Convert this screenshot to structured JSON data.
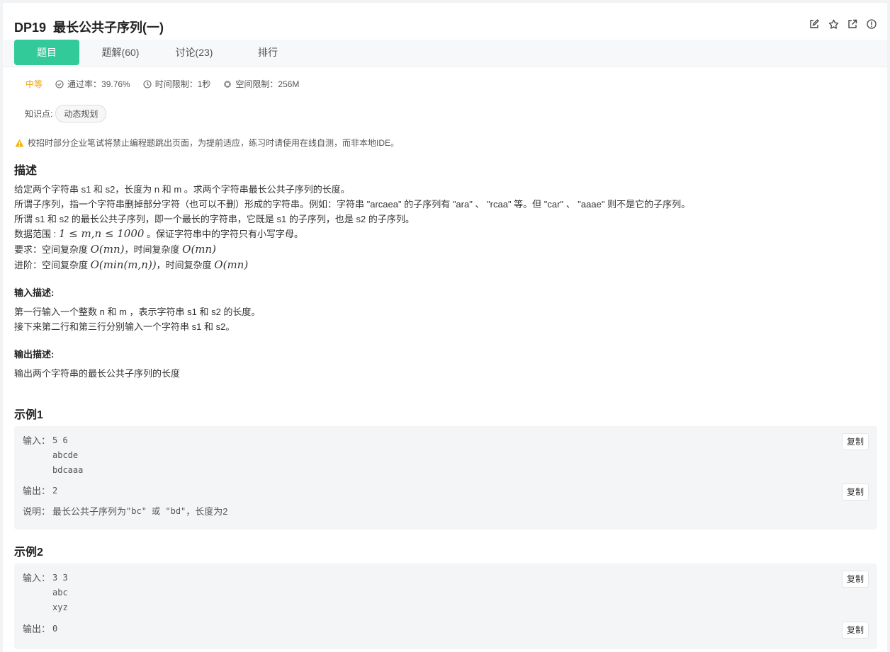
{
  "problem": {
    "title": "DP19  最长公共子序列(一)"
  },
  "header_icons": [
    "edit-icon",
    "star-icon",
    "external-link-icon",
    "info-icon"
  ],
  "tabs": [
    {
      "label": "题目",
      "active": true
    },
    {
      "label": "题解(60)",
      "active": false
    },
    {
      "label": "讨论(23)",
      "active": false
    },
    {
      "label": "排行",
      "active": false
    }
  ],
  "meta": {
    "difficulty": "中等",
    "pass_rate": "通过率：39.76%",
    "time_limit": "时间限制：1秒",
    "space_limit": "空间限制：256M"
  },
  "knowledge": {
    "label": "知识点:",
    "tags": [
      "动态规划"
    ]
  },
  "warning": "校招时部分企业笔试将禁止编程题跳出页面，为提前适应，练习时请使用在线自测，而非本地IDE。",
  "description": {
    "heading": "描述",
    "line1": "给定两个字符串 s1 和 s2，长度为 n 和 m  。求两个字符串最长公共子序列的长度。",
    "line2": "所谓子序列，指一个字符串删掉部分字符（也可以不删）形成的字符串。例如：字符串 \"arcaea\" 的子序列有 \"ara\" 、 \"rcaa\" 等。但 \"car\" 、 \"aaae\" 则不是它的子序列。",
    "line3": "所谓 s1 和 s2 的最长公共子序列，即一个最长的字符串，它既是 s1 的子序列，也是 s2 的子序列。",
    "line4_prefix": "数据范围 : ",
    "line4_math": "1 ≤ m,n ≤ 1000",
    "line4_suffix": " 。保证字符串中的字符只有小写字母。",
    "line5_prefix": "要求：空间复杂度 ",
    "line5_math1": "O(mn)",
    "line5_mid": "，时间复杂度 ",
    "line5_math2": "O(mn)",
    "line6_prefix": "进阶：空间复杂度 ",
    "line6_math1": "O(min(m,n))",
    "line6_mid": "，时间复杂度 ",
    "line6_math2": "O(mn)"
  },
  "input_desc": {
    "heading": "输入描述:",
    "line1": "第一行输入一个整数 n 和 m ，表示字符串 s1 和 s2 的长度。",
    "line2": "接下来第二行和第三行分别输入一个字符串 s1 和 s2。"
  },
  "output_desc": {
    "heading": "输出描述:",
    "line1": "输出两个字符串的最长公共子序列的长度"
  },
  "examples": [
    {
      "heading": "示例1",
      "input_label": "输入：",
      "input_lines": [
        "5 6",
        "abcde",
        "bdcaaa"
      ],
      "output_label": "输出：",
      "output": "2",
      "note_label": "说明：",
      "note_prefix": "最长公共子序列为 ",
      "note_code": "\"bc\" 或 \"bd\"",
      "note_suffix": " ，长度为2",
      "copy_label": "复制"
    },
    {
      "heading": "示例2",
      "input_label": "输入：",
      "input_lines": [
        "3 3",
        "abc",
        "xyz"
      ],
      "output_label": "输出：",
      "output": "0",
      "copy_label": "复制"
    }
  ],
  "colors": {
    "accent": "#32ca99",
    "difficulty": "#f0a000",
    "warning": "#f5b400"
  }
}
